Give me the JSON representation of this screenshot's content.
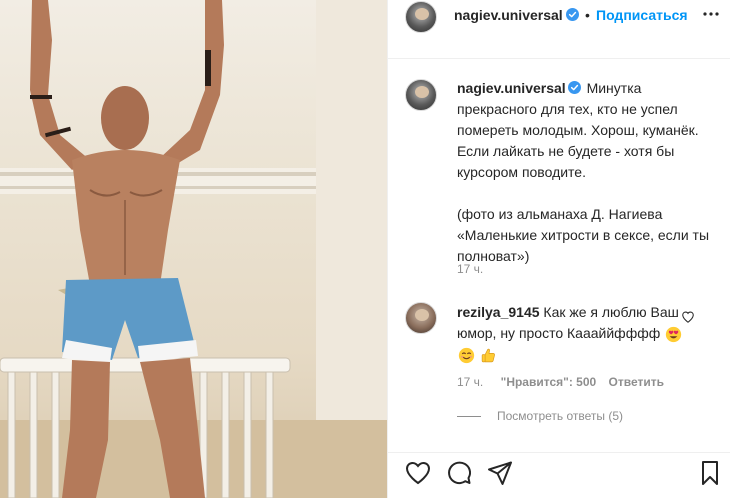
{
  "post": {
    "username": "nagiev.universal",
    "follow_label": "Подписаться",
    "dot": "•",
    "icons": [
      "verified-badge-icon",
      "more-options-icon"
    ]
  },
  "caption": {
    "username": "nagiev.universal",
    "text": "Минутка прекрасного для тех, кто не успел помереть молодым. Хорош, куманёк. Если лайкать не будете - хотя бы курсором поводите.",
    "note": "(фото из альманаха Д. Нагиева «Маленькие хитрости в сексе, если ты полноват»)",
    "time": "17 ч."
  },
  "comment": {
    "username": "rezilya_9145",
    "text": "Как же я люблю Ваш юмор, ну просто Каааййфффф",
    "emojis": [
      "heart-eyes-emoji",
      "smiling-emoji",
      "thumbs-up-emoji"
    ],
    "time": "17 ч.",
    "likes": "\"Нравится\": 500",
    "reply_label": "Ответить",
    "view_replies": "Посмотреть ответы (5)"
  },
  "actions": {
    "icons": [
      "like-heart-icon",
      "comment-icon",
      "share-icon",
      "save-bookmark-icon"
    ]
  },
  "colors": {
    "link_blue": "#0095f6",
    "verified_blue": "#3897f0",
    "text": "#262626",
    "muted": "#8e8e8e",
    "divider": "#efefef"
  }
}
